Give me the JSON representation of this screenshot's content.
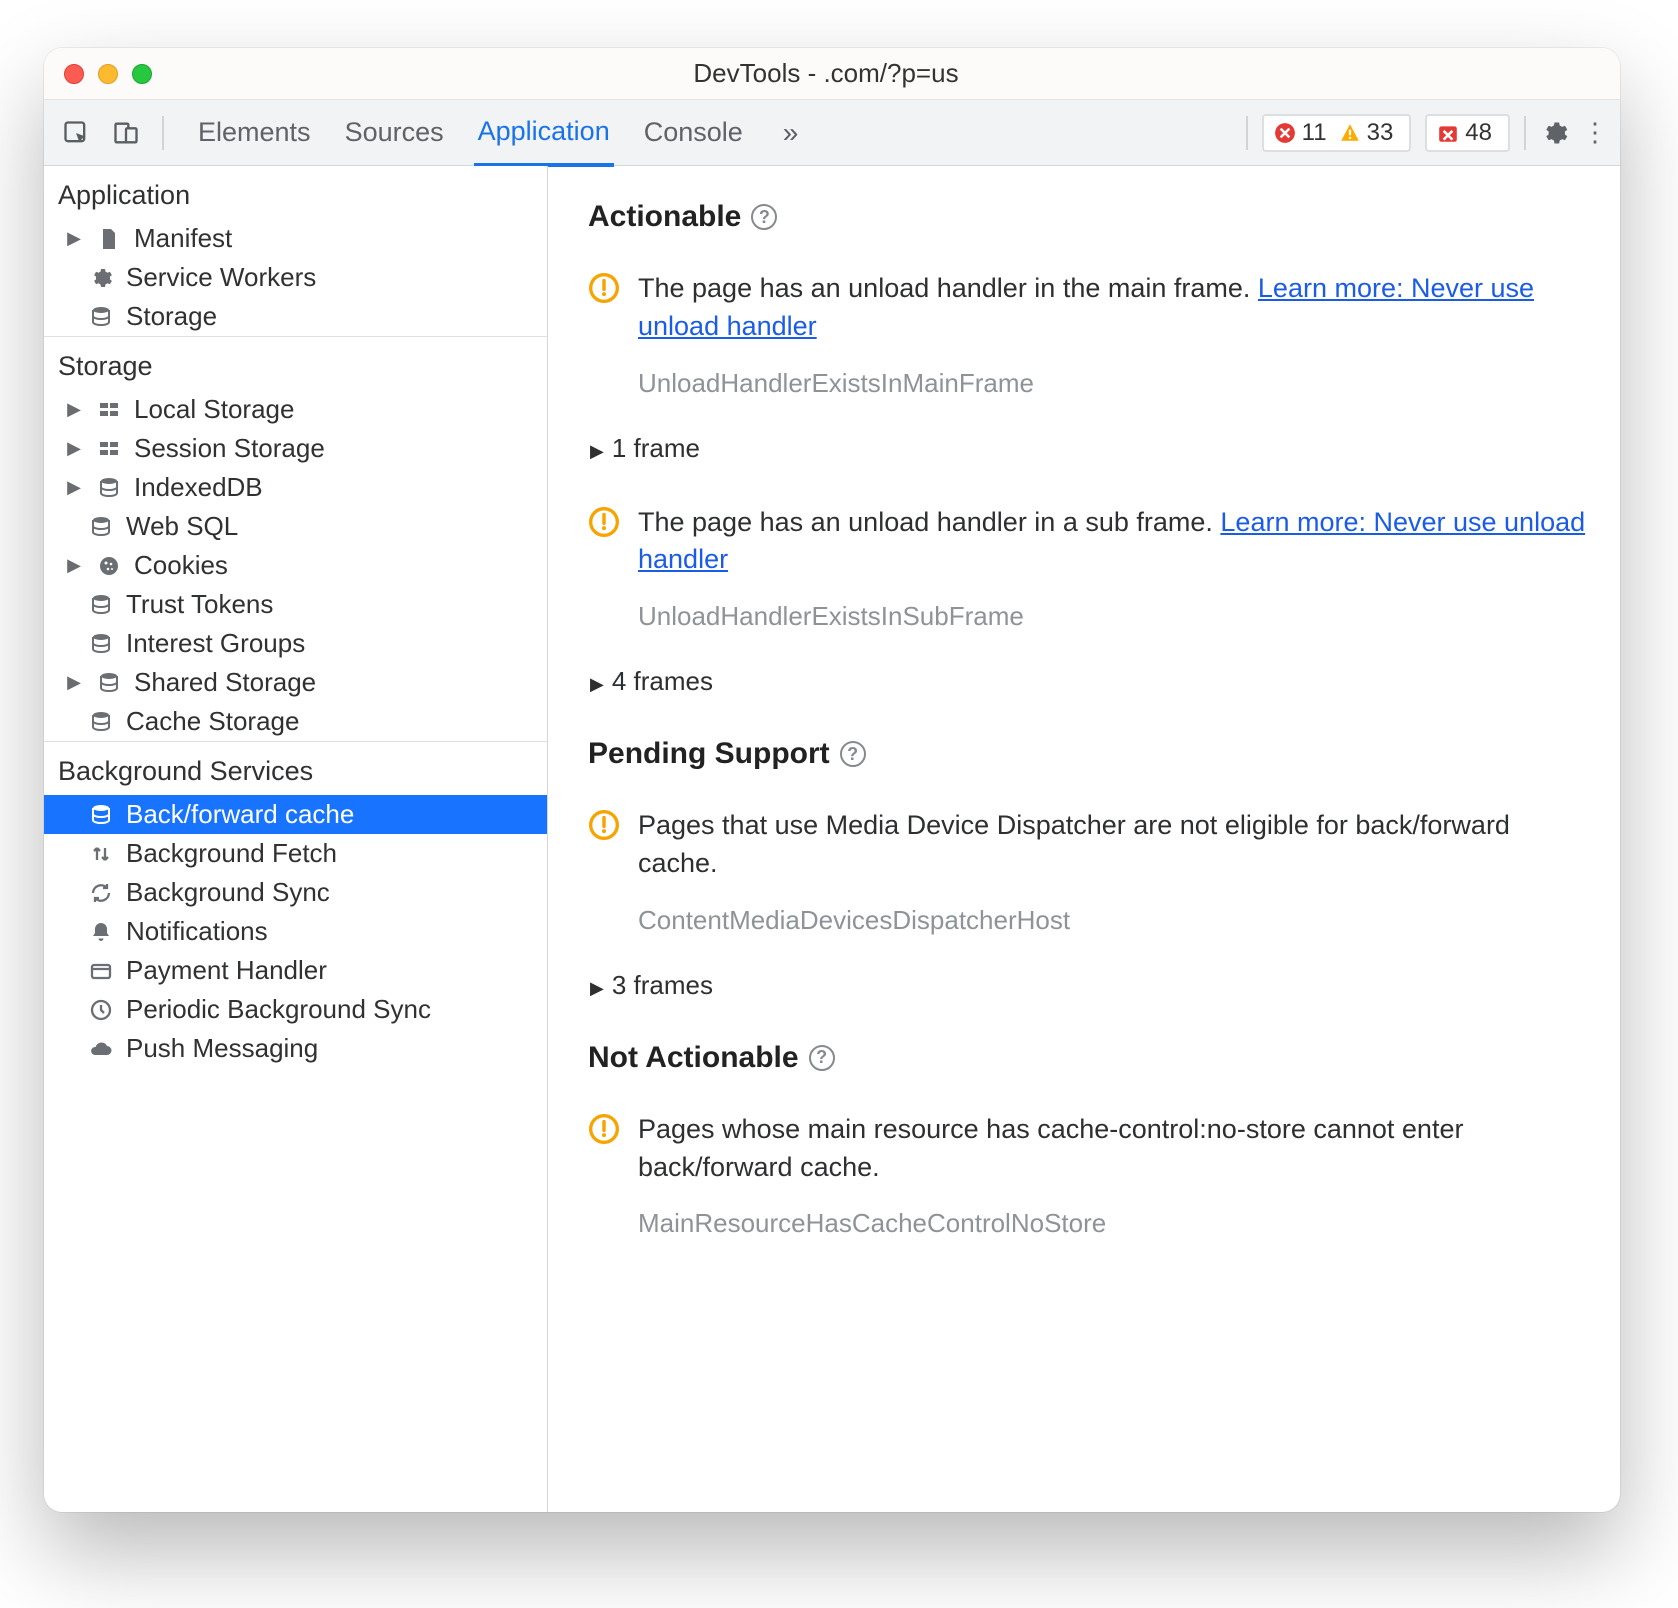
{
  "titlebar": {
    "title": "DevTools -            .com/?p=us"
  },
  "toolbar": {
    "tabs": [
      "Elements",
      "Sources",
      "Application",
      "Console"
    ],
    "activeTab": "Application",
    "errors": "11",
    "warnings": "33",
    "issues": "48"
  },
  "sidebar": {
    "groups": [
      {
        "title": "Application",
        "items": [
          {
            "icon": "file",
            "label": "Manifest",
            "expandable": true
          },
          {
            "icon": "gear",
            "label": "Service Workers"
          },
          {
            "icon": "db",
            "label": "Storage"
          }
        ]
      },
      {
        "title": "Storage",
        "items": [
          {
            "icon": "grid",
            "label": "Local Storage",
            "expandable": true
          },
          {
            "icon": "grid",
            "label": "Session Storage",
            "expandable": true
          },
          {
            "icon": "db",
            "label": "IndexedDB",
            "expandable": true
          },
          {
            "icon": "db",
            "label": "Web SQL"
          },
          {
            "icon": "cookie",
            "label": "Cookies",
            "expandable": true
          },
          {
            "icon": "db",
            "label": "Trust Tokens"
          },
          {
            "icon": "db",
            "label": "Interest Groups"
          },
          {
            "icon": "db",
            "label": "Shared Storage",
            "expandable": true
          },
          {
            "icon": "db",
            "label": "Cache Storage"
          }
        ]
      },
      {
        "title": "Background Services",
        "items": [
          {
            "icon": "db",
            "label": "Back/forward cache",
            "selected": true
          },
          {
            "icon": "updown",
            "label": "Background Fetch"
          },
          {
            "icon": "sync",
            "label": "Background Sync"
          },
          {
            "icon": "bell",
            "label": "Notifications"
          },
          {
            "icon": "card",
            "label": "Payment Handler"
          },
          {
            "icon": "clock",
            "label": "Periodic Background Sync"
          },
          {
            "icon": "cloud",
            "label": "Push Messaging"
          }
        ]
      }
    ]
  },
  "content": {
    "sections": [
      {
        "title": "Actionable",
        "issues": [
          {
            "msg": "The page has an unload handler in the main frame. ",
            "link": "Learn more: Never use unload handler",
            "code": "UnloadHandlerExistsInMainFrame",
            "frames": "1 frame"
          },
          {
            "msg": "The page has an unload handler in a sub frame. ",
            "link": "Learn more: Never use unload handler",
            "code": "UnloadHandlerExistsInSubFrame",
            "frames": "4 frames"
          }
        ]
      },
      {
        "title": "Pending Support",
        "issues": [
          {
            "msg": "Pages that use Media Device Dispatcher are not eligible for back/forward cache.",
            "code": "ContentMediaDevicesDispatcherHost",
            "frames": "3 frames"
          }
        ]
      },
      {
        "title": "Not Actionable",
        "issues": [
          {
            "msg": "Pages whose main resource has cache-control:no-store cannot enter back/forward cache.",
            "code": "MainResourceHasCacheControlNoStore"
          }
        ]
      }
    ]
  }
}
